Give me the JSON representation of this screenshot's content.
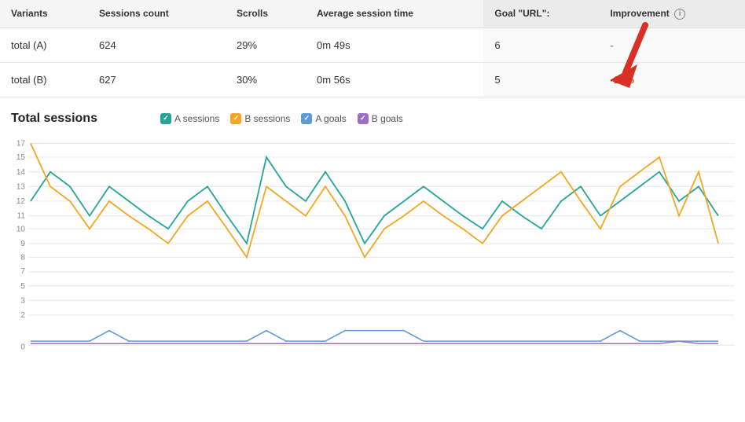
{
  "table": {
    "columns": [
      {
        "key": "variants",
        "label": "Variants",
        "goal": false
      },
      {
        "key": "sessions_count",
        "label": "Sessions count",
        "goal": false
      },
      {
        "key": "scrolls",
        "label": "Scrolls",
        "goal": false
      },
      {
        "key": "avg_session_time",
        "label": "Average session time",
        "goal": false
      },
      {
        "key": "goal_url",
        "label": "Goal \"URL\":",
        "goal": true
      },
      {
        "key": "improvement",
        "label": "Improvement",
        "goal": true
      }
    ],
    "rows": [
      {
        "variants": "total (A)",
        "sessions_count": "624",
        "scrolls": "29%",
        "avg_session_time": "0m 49s",
        "goal_url": "6",
        "improvement": "-"
      },
      {
        "variants": "total (B)",
        "sessions_count": "627",
        "scrolls": "30%",
        "avg_session_time": "0m 56s",
        "goal_url": "5",
        "improvement": "-17%"
      }
    ]
  },
  "chart": {
    "title": "Total sessions",
    "legend": [
      {
        "label": "A sessions",
        "color": "#26a69a"
      },
      {
        "label": "B sessions",
        "color": "#f5a623"
      },
      {
        "label": "A goals",
        "color": "#5c9bd6"
      },
      {
        "label": "B goals",
        "color": "#9c6fc6"
      }
    ],
    "y_labels": [
      "0",
      "2",
      "3",
      "5",
      "7",
      "8",
      "9",
      "10",
      "11",
      "12",
      "13",
      "14",
      "15",
      "17"
    ],
    "improvement_value": "-17%"
  }
}
